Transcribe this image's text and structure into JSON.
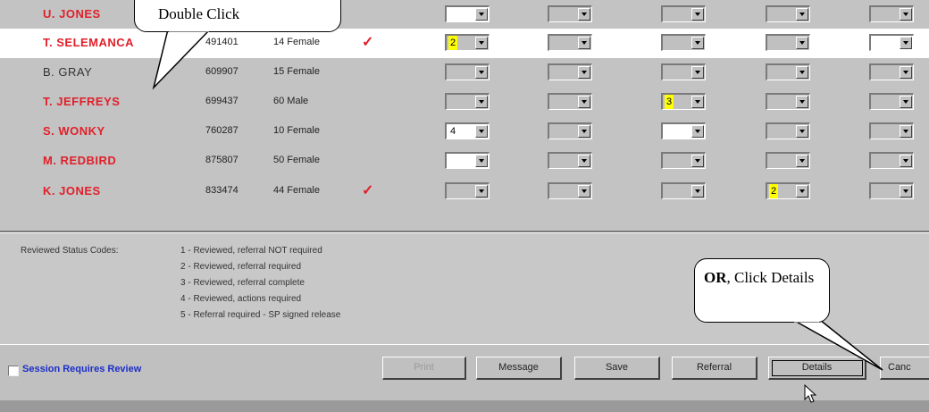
{
  "rows": [
    {
      "name": "U. JONES",
      "id": "",
      "age_gender": "",
      "check": false,
      "flagged": true,
      "selected": false,
      "cells": [
        {
          "value": "",
          "white": true
        },
        {
          "value": ""
        },
        {
          "value": ""
        },
        {
          "value": ""
        },
        {
          "value": ""
        }
      ]
    },
    {
      "name": "T. SELEMANCA",
      "id": "491401",
      "age_gender": "14 Female",
      "check": true,
      "flagged": true,
      "selected": true,
      "cells": [
        {
          "value": "2",
          "highlight": true
        },
        {
          "value": ""
        },
        {
          "value": ""
        },
        {
          "value": ""
        },
        {
          "value": "",
          "white": true
        }
      ]
    },
    {
      "name": "B. GRAY",
      "id": "609907",
      "age_gender": "15 Female",
      "check": false,
      "flagged": false,
      "selected": false,
      "cells": [
        {
          "value": ""
        },
        {
          "value": ""
        },
        {
          "value": ""
        },
        {
          "value": ""
        },
        {
          "value": ""
        }
      ]
    },
    {
      "name": "T. JEFFREYS",
      "id": "699437",
      "age_gender": "60 Male",
      "check": false,
      "flagged": true,
      "selected": false,
      "cells": [
        {
          "value": ""
        },
        {
          "value": ""
        },
        {
          "value": "3",
          "highlight": true
        },
        {
          "value": ""
        },
        {
          "value": ""
        }
      ]
    },
    {
      "name": "S. WONKY",
      "id": "760287",
      "age_gender": "10 Female",
      "check": false,
      "flagged": true,
      "selected": false,
      "cells": [
        {
          "value": "4",
          "white": true
        },
        {
          "value": ""
        },
        {
          "value": "",
          "white": true
        },
        {
          "value": ""
        },
        {
          "value": ""
        }
      ]
    },
    {
      "name": "M. REDBIRD",
      "id": "875807",
      "age_gender": "50 Female",
      "check": false,
      "flagged": true,
      "selected": false,
      "cells": [
        {
          "value": "",
          "white": true
        },
        {
          "value": ""
        },
        {
          "value": ""
        },
        {
          "value": ""
        },
        {
          "value": ""
        }
      ]
    },
    {
      "name": "K. JONES",
      "id": "833474",
      "age_gender": "44 Female",
      "check": true,
      "flagged": true,
      "selected": false,
      "cells": [
        {
          "value": ""
        },
        {
          "value": ""
        },
        {
          "value": ""
        },
        {
          "value": "2",
          "highlight": true
        },
        {
          "value": ""
        }
      ]
    }
  ],
  "check_glyph": "✓",
  "legend": {
    "title": "Reviewed Status Codes:",
    "codes": [
      "1 - Reviewed, referral NOT required",
      "2 - Reviewed, referral required",
      "3 - Reviewed, referral complete",
      "4 - Reviewed, actions required",
      "5 - Referral required - SP signed release"
    ]
  },
  "footer": {
    "session_label": "Session Requires Review",
    "buttons": [
      {
        "label": "Print",
        "disabled": true
      },
      {
        "label": "Message"
      },
      {
        "label": "Save"
      },
      {
        "label": "Referral"
      },
      {
        "label": "Details",
        "focused": true
      },
      {
        "label": "Canc"
      }
    ]
  },
  "callouts": {
    "double_click": "Double Click",
    "or_bold": "OR",
    "or_rest": ", Click Details"
  },
  "colors": {
    "flag_name": "#e0202a",
    "session_label": "#1b2ec9",
    "highlight": "#ffff00"
  }
}
